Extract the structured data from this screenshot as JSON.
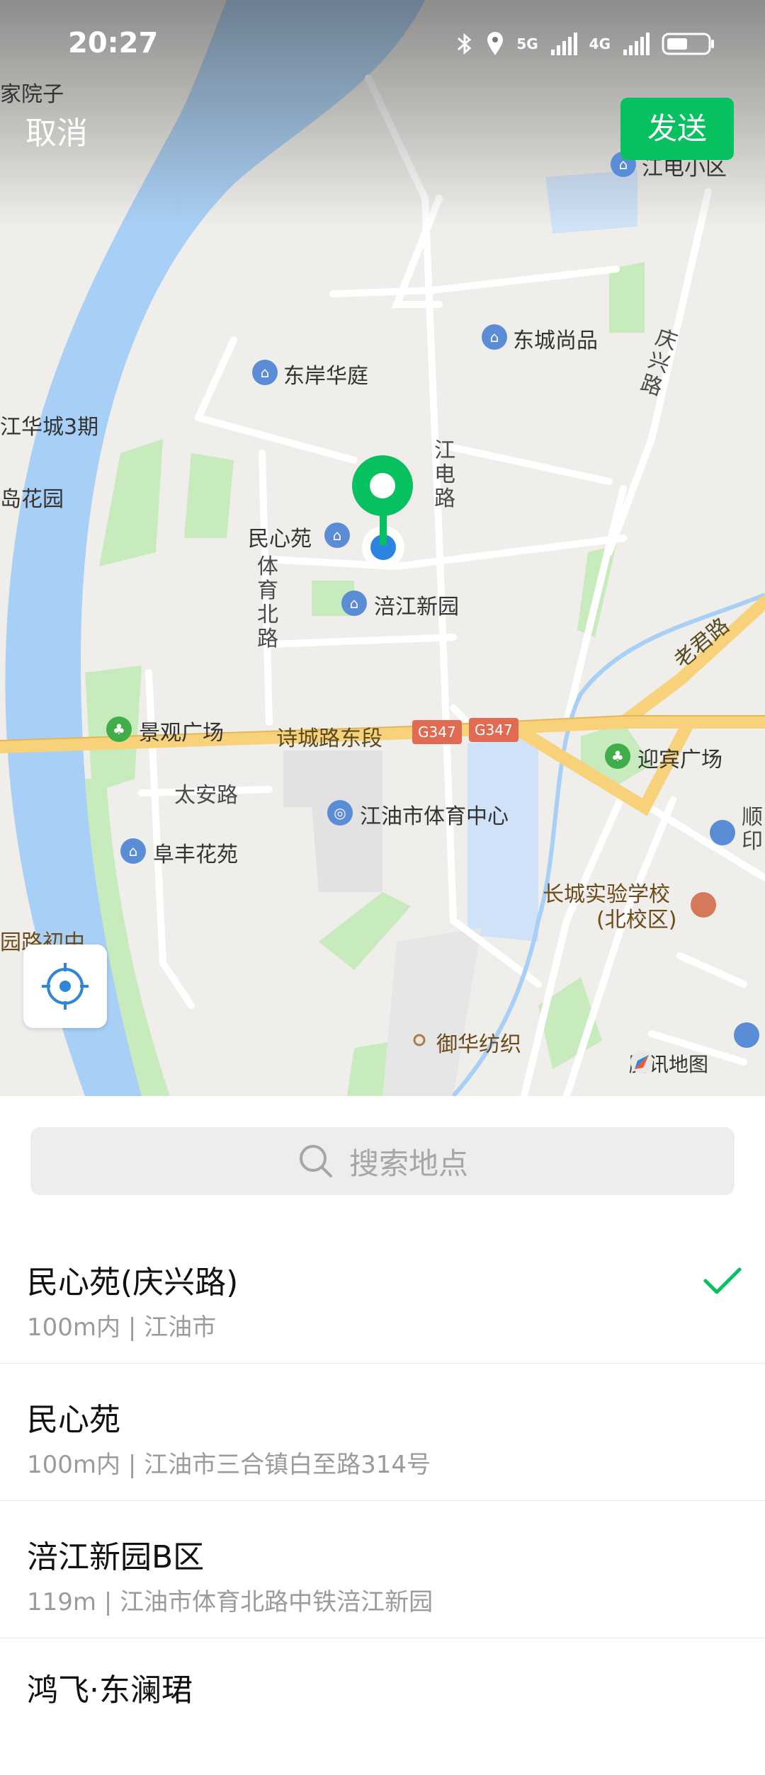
{
  "status_bar": {
    "time": "20:27",
    "network_1": "5G",
    "network_2": "4G"
  },
  "header": {
    "cancel_label": "取消",
    "send_label": "发送"
  },
  "map": {
    "brand": "腾讯地图",
    "labels": {
      "top_left": "家院子",
      "jiangdian": "江电小区",
      "dongcheng": "东城尚品",
      "dongan": "东岸华庭",
      "huacheng": "江华城3期",
      "huayuan": "岛花园",
      "minxin": "民心苑",
      "fujiang": "涪江新园",
      "jingguan": "景观广场",
      "yingbin": "迎宾广场",
      "taian": "太安路",
      "tiyu_center": "江油市体育中心",
      "fufeng": "阜丰花苑",
      "changcheng_1": "长城实验学校",
      "changcheng_2": "(北校区)",
      "shun": "顺印",
      "school_left": "园路初中",
      "yuhua": "御华纺织",
      "shicheng": "诗城路东段",
      "laojun": "老君路",
      "qingxing": "庆兴路",
      "jiangdianlu": "江电路",
      "tiyubeilu": "体育北路",
      "g347_a": "G347",
      "g347_b": "G347"
    }
  },
  "search": {
    "placeholder": "搜索地点"
  },
  "places": [
    {
      "name": "民心苑(庆兴路)",
      "detail": "100m内 | 江油市",
      "selected": true
    },
    {
      "name": "民心苑",
      "detail": "100m内 | 江油市三合镇白至路314号",
      "selected": false
    },
    {
      "name": "涪江新园B区",
      "detail": "119m | 江油市体育北路中铁涪江新园",
      "selected": false
    },
    {
      "name": "鸿飞·东澜珺",
      "detail": "",
      "selected": false
    }
  ],
  "colors": {
    "accent": "#07c160",
    "river": "#a8cff5",
    "main_road": "#f7d27a",
    "park": "#c8ebbd"
  }
}
